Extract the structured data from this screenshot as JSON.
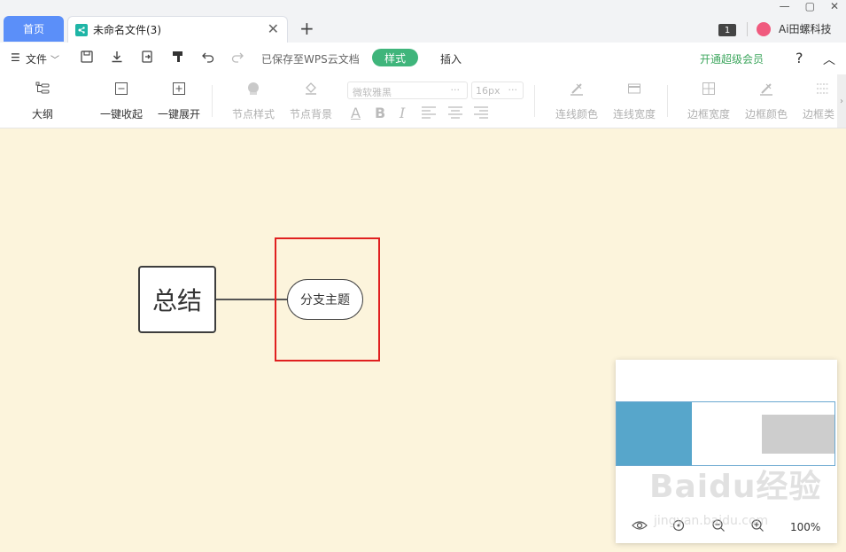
{
  "tabs": {
    "home": "首页",
    "document": "未命名文件(3)",
    "close": "✕",
    "new_tab": "+"
  },
  "window": {
    "minimize": "—",
    "maximize": "▢",
    "close": "✕",
    "badge": "1",
    "user": "Ai田螺科技"
  },
  "menu": {
    "file": "文件",
    "saved_status": "已保存至WPS云文档",
    "style": "样式",
    "insert": "插入",
    "vip": "开通超级会员",
    "help": "?",
    "collapse": "︿"
  },
  "toolbar": {
    "outline": "大纲",
    "collapse_all": "一键收起",
    "expand_all": "一键展开",
    "node_style": "节点样式",
    "node_bg": "节点背景",
    "font_family": "微软雅黑",
    "font_size": "16px",
    "line_color": "连线颜色",
    "line_width": "连线宽度",
    "border_width": "边框宽度",
    "border_color": "边框颜色",
    "border_type": "边框类"
  },
  "canvas": {
    "root_node": "总结",
    "branch_node": "分支主题"
  },
  "minimap": {
    "zoom": "100%"
  },
  "watermark": {
    "brand": "Baidu经验",
    "url": "jingyan.baidu.com"
  },
  "colors": {
    "home_tab": "#5b8ff9",
    "style_pill": "#3fb57b",
    "vip_text": "#3fa75f",
    "canvas_bg": "#fcf4dc",
    "highlight": "#e02020",
    "minimap_root": "#57a6cb"
  }
}
